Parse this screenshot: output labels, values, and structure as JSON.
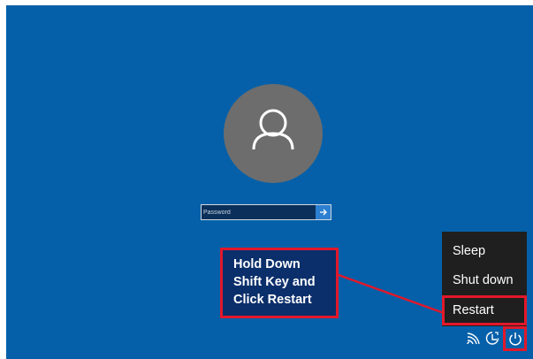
{
  "login": {
    "password_placeholder": "Password",
    "submit_icon": "arrow-right-icon",
    "user_icon": "user-avatar-icon"
  },
  "annotation": {
    "lines": [
      "Hold Down",
      "Shift Key and",
      "Click Restart"
    ]
  },
  "power_menu": {
    "items": [
      {
        "label": "Sleep"
      },
      {
        "label": "Shut down"
      },
      {
        "label": "Restart"
      }
    ]
  },
  "tray": {
    "icons": [
      "network-icon",
      "ease-of-access-icon",
      "power-icon"
    ]
  },
  "colors": {
    "background": "#0560a9",
    "avatar": "#6d6d6d",
    "menu_background": "#1f1f1f",
    "highlight": "#e2182a",
    "annotation_background": "#0b2f6b"
  }
}
